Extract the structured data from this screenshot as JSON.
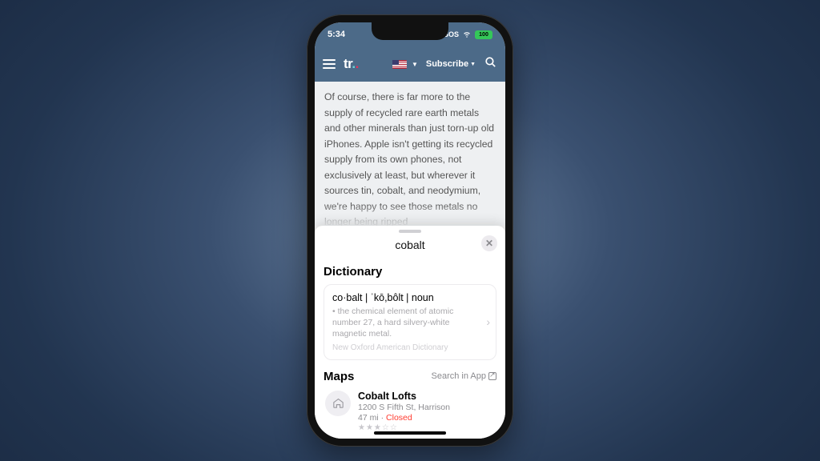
{
  "statusbar": {
    "time": "5:34",
    "sos": "SOS",
    "battery": "100"
  },
  "header": {
    "subscribe_label": "Subscribe"
  },
  "article": {
    "body": "Of course, there is far more to the supply of recycled rare earth metals and other minerals than just torn-up old iPhones. Apple isn't getting its recycled supply from its own phones, not exclusively at least, but wherever it sources tin, cobalt, and neodymium, we're happy to see those metals no longer being ripped"
  },
  "lookup": {
    "term": "cobalt",
    "dictionary": {
      "section_label": "Dictionary",
      "headword": "co·balt  |  ˈkō,bôlt  |  noun",
      "definition": "• the chemical element of atomic number 27, a hard silvery-white magnetic metal.",
      "source": "New Oxford American Dictionary"
    },
    "maps": {
      "section_label": "Maps",
      "search_in_app": "Search in App",
      "result": {
        "name": "Cobalt Lofts",
        "address": "1200 S Fifth St, Harrison",
        "distance": "47 mi",
        "status": "Closed"
      }
    }
  }
}
